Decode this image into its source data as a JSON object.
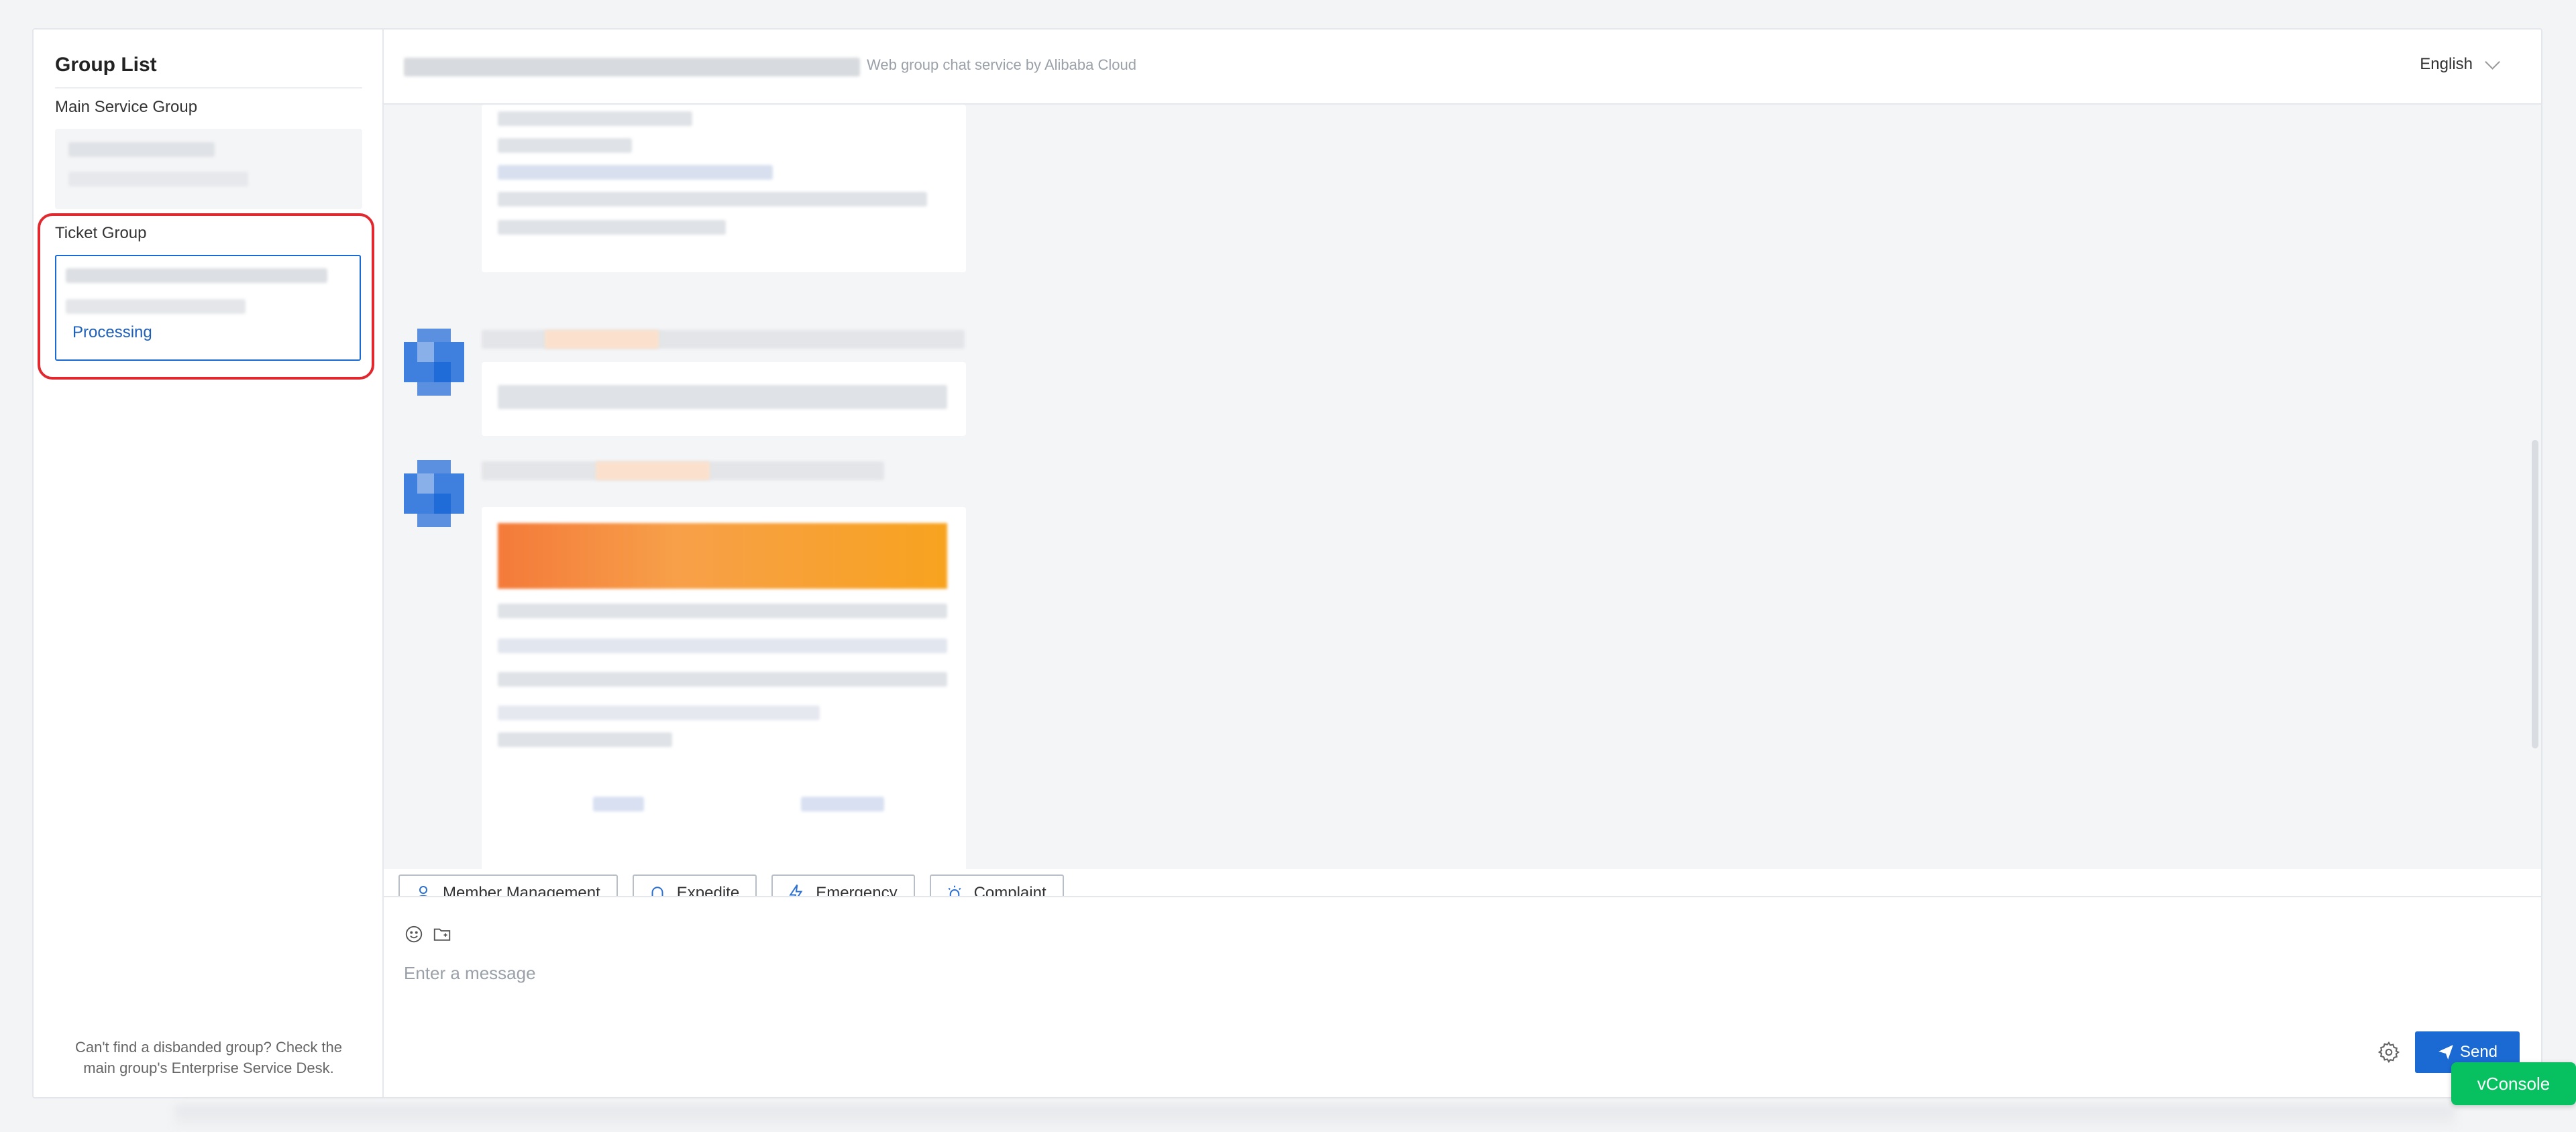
{
  "sidebar": {
    "title": "Group List",
    "main_group_label": "Main Service Group",
    "ticket_group_label": "Ticket Group",
    "ticket_status": "Processing",
    "footer_text": "Can't find a disbanded group? Check the main group's Enterprise Service Desk."
  },
  "header": {
    "subtitle": "Web group chat service by Alibaba Cloud",
    "language": "English"
  },
  "quick_actions": [
    {
      "label": "Member Management",
      "icon": "user-icon"
    },
    {
      "label": "Expedite",
      "icon": "bell-icon"
    },
    {
      "label": "Emergency",
      "icon": "lightning-icon"
    },
    {
      "label": "Complaint",
      "icon": "alarm-icon"
    }
  ],
  "composer": {
    "placeholder": "Enter a message",
    "send_label": "Send"
  },
  "vconsole_label": "vConsole",
  "colors": {
    "accent": "#1b6ad3",
    "highlight": "#e0282e",
    "vconsole": "#07c160"
  }
}
